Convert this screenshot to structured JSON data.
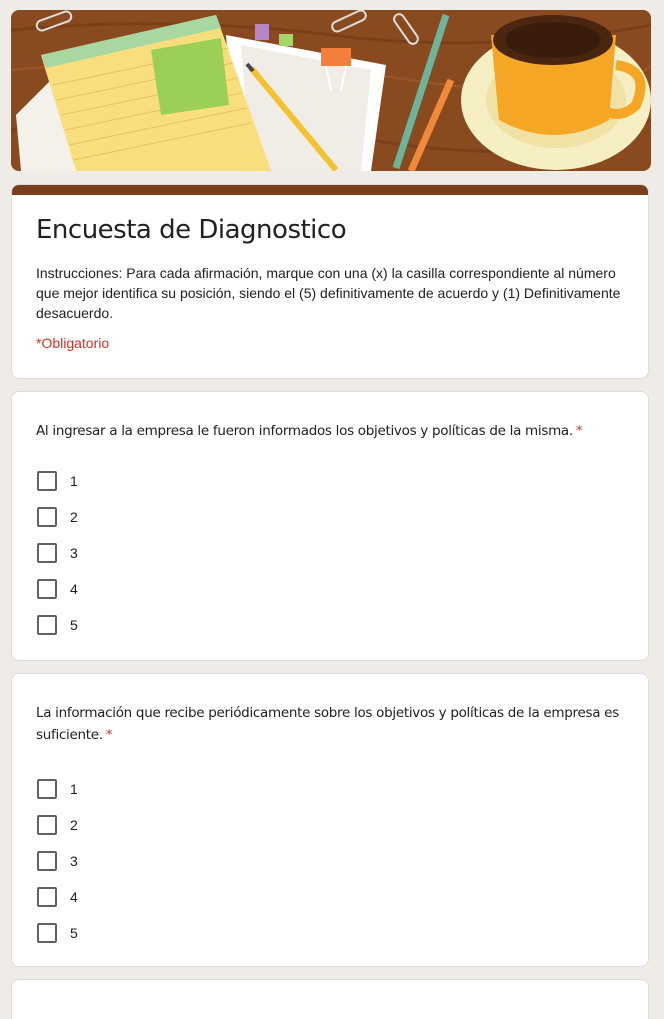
{
  "form": {
    "title": "Encuesta de Diagnostico",
    "description": "Instrucciones: Para cada afirmación, marque con una (x) la casilla correspondiente al número que mejor identifica su posición, siendo el (5) definitivamente de acuerdo y (1) Definitivamente desacuerdo.",
    "required_note": "*Obligatorio"
  },
  "questions": [
    {
      "text": "Al ingresar a la empresa le fueron informados los objetivos y políticas de la misma.",
      "required_mark": "*",
      "options": [
        "1",
        "2",
        "3",
        "4",
        "5"
      ]
    },
    {
      "text": "La información que recibe periódicamente sobre los objetivos y políticas de la empresa es suficiente.",
      "required_mark": "*",
      "options": [
        "1",
        "2",
        "3",
        "4",
        "5"
      ]
    }
  ],
  "colors": {
    "accent": "#7a3f1e",
    "required": "#d93025",
    "background": "#efebe7"
  }
}
